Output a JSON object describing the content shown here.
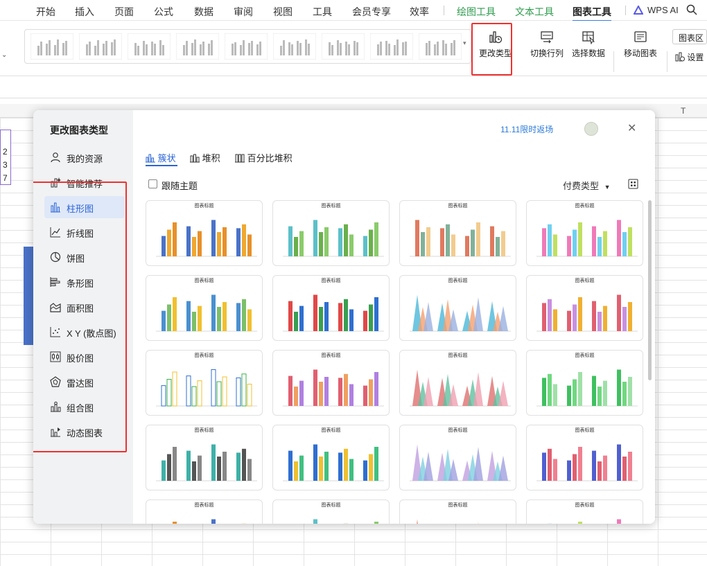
{
  "menubar": {
    "items": [
      "开始",
      "插入",
      "页面",
      "公式",
      "数据",
      "审阅",
      "视图",
      "工具",
      "会员专享",
      "效率"
    ],
    "context_tabs": [
      "绘图工具",
      "文本工具",
      "图表工具"
    ],
    "wps_ai": "WPS AI"
  },
  "ribbon": {
    "change_type": "更改类型",
    "switch_row_col": "切换行列",
    "select_data": "选择数据",
    "move_chart": "移动图表",
    "chart_area": "图表区",
    "settings": "设置"
  },
  "sheet": {
    "col_t": "T",
    "row_values": [
      "2",
      "3",
      "7"
    ]
  },
  "dialog": {
    "title": "更改图表类型",
    "promo": "11.11限时返场",
    "sidebar": [
      "我的资源",
      "智能推荐",
      "柱形图",
      "折线图",
      "饼图",
      "条形图",
      "面积图",
      "X Y (散点图)",
      "股价图",
      "雷达图",
      "组合图",
      "动态图表"
    ],
    "tabs": [
      "簇状",
      "堆积",
      "百分比堆积"
    ],
    "follow_theme": "跟随主题",
    "paid_type": "付费类型",
    "card_titles": [
      "图表标题",
      "图表标题",
      "图表标题",
      "图表标题",
      "图表标题",
      "图表标题",
      "图表标题",
      "图表标题",
      "图表标题",
      "图表标题",
      "图表标题",
      "图表标题",
      "图表标题",
      "图表标题",
      "图表标题",
      "图表标题"
    ]
  },
  "colors": {
    "accent_blue": "#2a64d6",
    "highlight_red": "#f03030",
    "ribbon_green": "#2e9b4e"
  }
}
